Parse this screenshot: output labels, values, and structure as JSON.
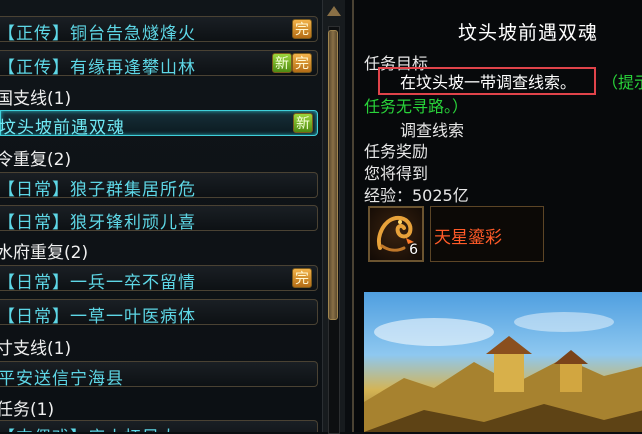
{
  "quest_list": {
    "rows": [
      {
        "text": "【正传】铜台告急燧烽火",
        "badge": "完"
      },
      {
        "text": "【正传】有缘再逢攀山林",
        "badge_new": "新",
        "badge": "完"
      },
      {
        "text": "坟头坡前遇双魂",
        "badge_new": "新"
      },
      {
        "text": "【日常】狼子群集居所危"
      },
      {
        "text": "【日常】狼牙锋利顽儿喜"
      },
      {
        "text": "【日常】一兵一卒不留情",
        "badge": "完"
      },
      {
        "text": "【日常】一草一叶医病体"
      },
      {
        "text": "平安送信宁海县"
      },
      {
        "text": "【支偶戏】店小杠风大"
      }
    ],
    "categories": [
      "国支线(1)",
      "令重复(2)",
      "水府重复(2)",
      "寸支线(1)",
      "任务(1)"
    ]
  },
  "detail": {
    "title": "坟头坡前遇双魂",
    "objective_label": "任务目标",
    "objective_text": "在坟头坡一带调查线索。",
    "hint_part1": "（提示",
    "hint_part2": "任务无寻路。）",
    "sub_objective": "调查线索",
    "reward_label": "任务奖励",
    "receive_label": "您将得到",
    "exp_text": "经验：5025亿",
    "item": {
      "name": "天星鎏彩",
      "qty": "6",
      "icon": "golden-dragon-icon"
    }
  }
}
